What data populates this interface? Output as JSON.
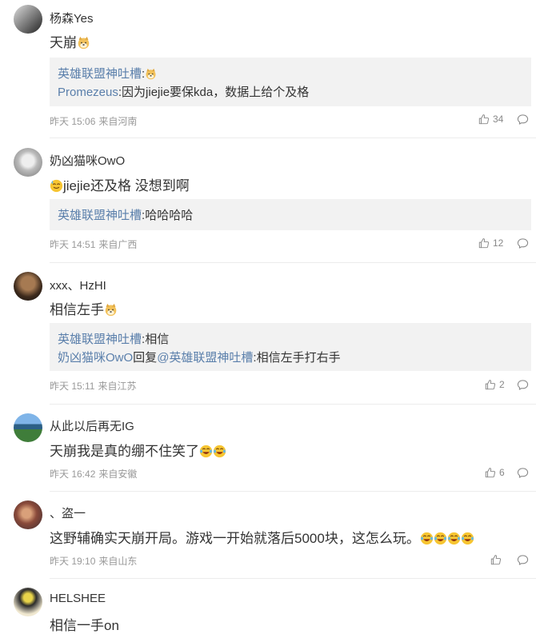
{
  "comments": [
    {
      "username": "杨森Yes",
      "content": "天崩",
      "quote_line1_user": "英雄联盟神吐槽",
      "quote_line2_user": "Promezeus",
      "quote_line2_text": "因为jiejie要保kda，数据上给个及格",
      "time": "昨天 15:06",
      "location": "来自河南",
      "likes": "34"
    },
    {
      "username": "奶凶猫咪OwO",
      "content": "jiejie还及格 没想到啊",
      "quote_line1_user": "英雄联盟神吐槽",
      "quote_line1_text": "哈哈哈哈",
      "time": "昨天 14:51",
      "location": "来自广西",
      "likes": "12"
    },
    {
      "username": "xxx、HzHI",
      "content": "相信左手",
      "quote_line1_user": "英雄联盟神吐槽",
      "quote_line1_text": "相信",
      "quote_line2_user": "奶凶猫咪OwO",
      "quote_line2_reply": "回复",
      "quote_line2_mention": "@英雄联盟神吐槽",
      "quote_line2_text": "相信左手打右手",
      "time": "昨天 15:11",
      "location": "来自江苏",
      "likes": "2"
    },
    {
      "username": "从此以后再无IG",
      "content": "天崩我是真的绷不住笑了",
      "time": "昨天 16:42",
      "location": "来自安徽",
      "likes": "6"
    },
    {
      "username": "、盗一",
      "content": "这野辅确实天崩开局。游戏一开始就落后5000块，这怎么玩。",
      "time": "昨天 19:10",
      "location": "来自山东",
      "likes": ""
    },
    {
      "username": "HELSHEE",
      "content": "相信一手on"
    }
  ],
  "icons": {
    "like": "thumbs-up-icon",
    "reply": "speech-bubble-icon",
    "emoji_doge": "doge-emoji-icon",
    "emoji_laugh": "laugh-tears-emoji-icon",
    "emoji_sweat": "sweat-smile-emoji-icon"
  },
  "colors": {
    "link": "#5a7fab",
    "quote_bg": "#f2f2f2",
    "meta": "#999999"
  }
}
